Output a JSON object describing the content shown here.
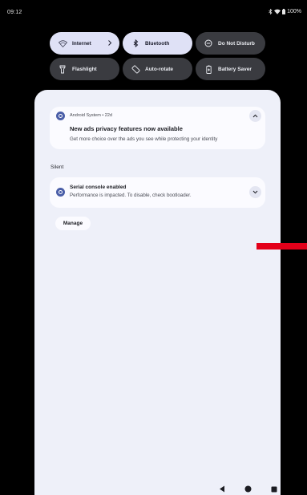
{
  "status_bar": {
    "time": "09:12",
    "battery": "100%",
    "icons": [
      "bluetooth-icon",
      "wifi-icon",
      "battery-icon"
    ]
  },
  "quick_settings": {
    "tiles": [
      {
        "label": "Internet",
        "icon": "wifi-icon",
        "active": true
      },
      {
        "label": "Bluetooth",
        "icon": "bluetooth-icon",
        "active": true
      },
      {
        "label": "Do Not Disturb",
        "icon": "do-not-disturb-icon",
        "active": false
      },
      {
        "label": "Flashlight",
        "icon": "flashlight-icon",
        "active": false
      },
      {
        "label": "Auto-rotate",
        "icon": "rotate-icon",
        "active": false
      },
      {
        "label": "Battery Saver",
        "icon": "battery-saver-icon",
        "active": false
      }
    ]
  },
  "notifications": {
    "ads": {
      "header": "Android System • 22d",
      "title": "New ads privacy features now available",
      "body": "Get more choice over the ads you see while protecting your identity"
    },
    "silent_label": "Silent",
    "serial": {
      "title": "Serial console enabled",
      "body": "Performance is impacted. To disable, check bootloader."
    },
    "manage_label": "Manage"
  },
  "colors": {
    "active_tile": "#dfe1f6",
    "inactive_tile": "#3a3b40",
    "shade": "#eef0f9",
    "card": "#fbfbff",
    "accent": "#4b5fa8",
    "red_marker": "#e3001a"
  },
  "nav_bar": {
    "buttons": [
      "back-icon",
      "home-icon",
      "recents-icon"
    ]
  }
}
